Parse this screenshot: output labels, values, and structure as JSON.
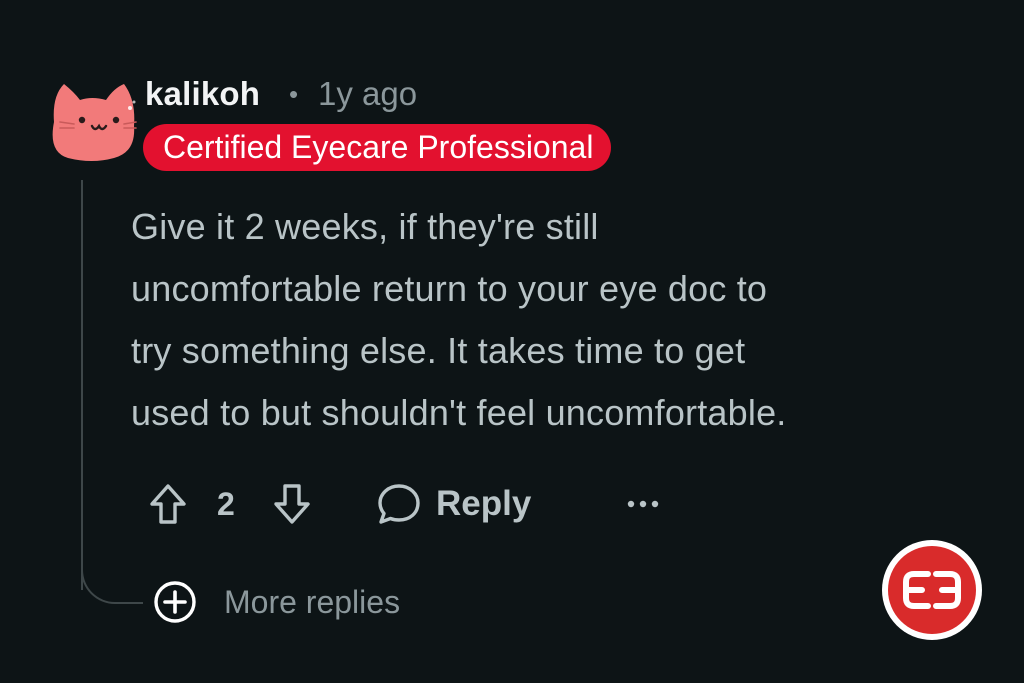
{
  "comment": {
    "username": "kalikoh",
    "separator": "•",
    "timestamp": "1y ago",
    "flair": "Certified Eyecare Professional",
    "body_lines": [
      "Give it 2 weeks, if they're still",
      "uncomfortable return to your eye doc to",
      "try something else. It takes time to get",
      "used to but shouldn't feel uncomfortable."
    ],
    "actions": {
      "vote_count": "2",
      "reply_label": "Reply"
    }
  },
  "more_replies_label": "More replies",
  "icons": {
    "avatar": "cat-avatar-icon",
    "upvote": "arrow-up-icon",
    "downvote": "arrow-down-icon",
    "reply": "speech-bubble-icon",
    "more": "ellipsis-icon",
    "expand": "plus-circle-icon",
    "logo": "brand-logo-icon"
  },
  "colors": {
    "background": "#0d1416",
    "flair_bg": "#e3112f",
    "avatar": "#f27a7a",
    "logo": "#d92b2b"
  }
}
